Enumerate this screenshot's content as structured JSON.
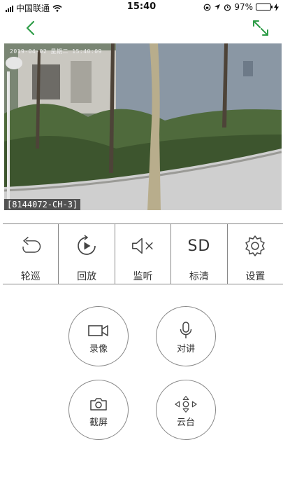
{
  "status_bar": {
    "carrier": "中国联通",
    "time": "15:40",
    "battery": "97%",
    "battery_level": 0.97
  },
  "nav": {
    "back_icon": "chevron-left-icon",
    "fullscreen_icon": "expand-arrows-icon",
    "accent_color": "#2e9d48"
  },
  "video": {
    "osd_timestamp": "2019-04-02  星期二  15:40:09",
    "channel_label": "[8144072-CH-3]"
  },
  "toolbar": [
    {
      "label": "轮巡",
      "icon": "patrol-cycle-icon"
    },
    {
      "label": "回放",
      "icon": "playback-icon"
    },
    {
      "label": "监听",
      "icon": "speaker-muted-icon"
    },
    {
      "label": "标清",
      "icon": "sd-quality-icon",
      "icon_text": "SD"
    },
    {
      "label": "设置",
      "icon": "gear-icon"
    }
  ],
  "actions": {
    "record": {
      "label": "录像",
      "icon": "video-camera-icon"
    },
    "talk": {
      "label": "对讲",
      "icon": "microphone-icon"
    },
    "screenshot": {
      "label": "截屏",
      "icon": "camera-icon"
    },
    "ptz": {
      "label": "云台",
      "icon": "ptz-direction-icon"
    }
  }
}
